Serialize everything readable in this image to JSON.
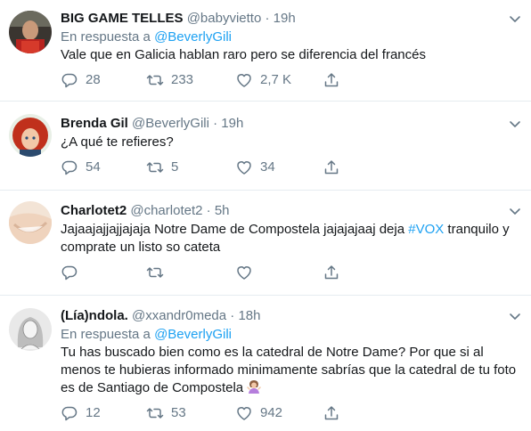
{
  "tweets": [
    {
      "name": "BIG GAME TELLES",
      "handle": "@babyvietto",
      "time": "19h",
      "reply_label": "En respuesta a",
      "reply_to": "@BeverlyGili",
      "text": "Vale que en Galicia hablan raro pero se diferencia del francés",
      "replies": "28",
      "retweets": "233",
      "likes": "2,7 K"
    },
    {
      "name": "Brenda Gil",
      "handle": "@BeverlyGili",
      "time": "19h",
      "text": "¿A qué te refieres?",
      "replies": "54",
      "retweets": "5",
      "likes": "34"
    },
    {
      "name": "Charlotet2",
      "handle": "@charlotet2",
      "time": "5h",
      "text_before": "Jajaajajjajjajaja Notre Dame de Compostela jajajajaaj deja ",
      "hashtag": "#VOX",
      "text_after": " tranquilo y comprate un listo so cateta",
      "replies": "",
      "retweets": "",
      "likes": ""
    },
    {
      "name": "(Lía)ndola.",
      "handle": "@xxandr0meda",
      "time": "18h",
      "reply_label": "En respuesta a",
      "reply_to": "@BeverlyGili",
      "text": "Tu has buscado bien como es la catedral de Notre Dame? Por que si al menos te hubieras informado minimamente sabrías que la catedral de tu foto es de Santiago de Compostela",
      "emoji": "woman-shrugging-emoji",
      "replies": "12",
      "retweets": "53",
      "likes": "942"
    }
  ],
  "separator": "·",
  "icons": {
    "reply": "reply-icon",
    "retweet": "retweet-icon",
    "like": "like-icon",
    "share": "share-icon",
    "caret": "chevron-down-icon"
  },
  "colors": {
    "text": "#14171a",
    "secondary": "#657786",
    "link": "#1da1f2",
    "divider": "#e6ecf0"
  }
}
